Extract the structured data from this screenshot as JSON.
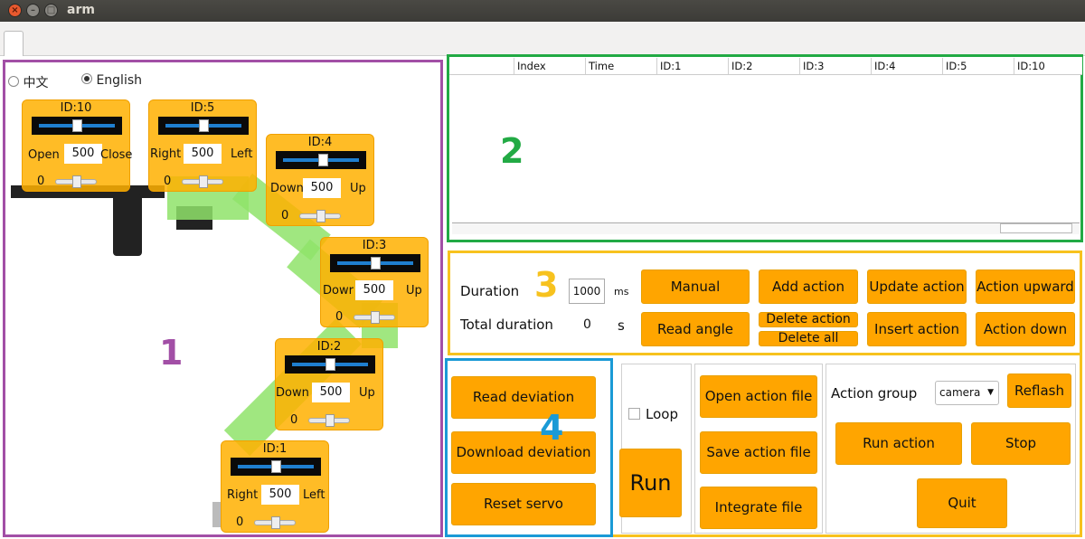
{
  "window": {
    "title": "arm"
  },
  "language": {
    "chinese": "中文",
    "english": "English",
    "selected": "English"
  },
  "servos": [
    {
      "id_label": "ID:10",
      "left_label": "Open",
      "right_label": "Close",
      "value": "500",
      "min": "0"
    },
    {
      "id_label": "ID:5",
      "left_label": "Right",
      "right_label": "Left",
      "value": "500",
      "min": "0"
    },
    {
      "id_label": "ID:4",
      "left_label": "Down",
      "right_label": "Up",
      "value": "500",
      "min": "0"
    },
    {
      "id_label": "ID:3",
      "left_label": "Dowr",
      "right_label": "Up",
      "value": "500",
      "min": "0"
    },
    {
      "id_label": "ID:2",
      "left_label": "Down",
      "right_label": "Up",
      "value": "500",
      "min": "0"
    },
    {
      "id_label": "ID:1",
      "left_label": "Right",
      "right_label": "Left",
      "value": "500",
      "min": "0"
    }
  ],
  "table": {
    "columns": [
      "Index",
      "Time",
      "ID:1",
      "ID:2",
      "ID:3",
      "ID:4",
      "ID:5",
      "ID:10"
    ]
  },
  "region_labels": [
    "1",
    "2",
    "3",
    "4"
  ],
  "duration": {
    "label": "Duration",
    "value": "1000",
    "unit": "ms",
    "total_label": "Total duration",
    "total_value": "0",
    "total_unit": "s"
  },
  "buttons": {
    "manual": "Manual",
    "add_action": "Add action",
    "update_action": "Update action",
    "action_upward": "Action upward",
    "read_angle": "Read angle",
    "delete_action": "Delete action",
    "delete_all": "Delete all",
    "insert_action": "Insert action",
    "action_down": "Action down",
    "read_deviation": "Read deviation",
    "download_deviation": "Download deviation",
    "reset_servo": "Reset servo",
    "run": "Run",
    "open_action_file": "Open action file",
    "save_action_file": "Save action file",
    "integrate_file": "Integrate file",
    "reflash": "Reflash",
    "run_action": "Run action",
    "stop": "Stop",
    "quit": "Quit"
  },
  "loop": {
    "label": "Loop",
    "checked": false
  },
  "action_group": {
    "label": "Action group",
    "selected": "camera"
  },
  "colors": {
    "purple": "#a24fa6",
    "green": "#22aa44",
    "yellow": "#f7c21e",
    "blue": "#1a9ad6",
    "button": "#ffa500"
  }
}
